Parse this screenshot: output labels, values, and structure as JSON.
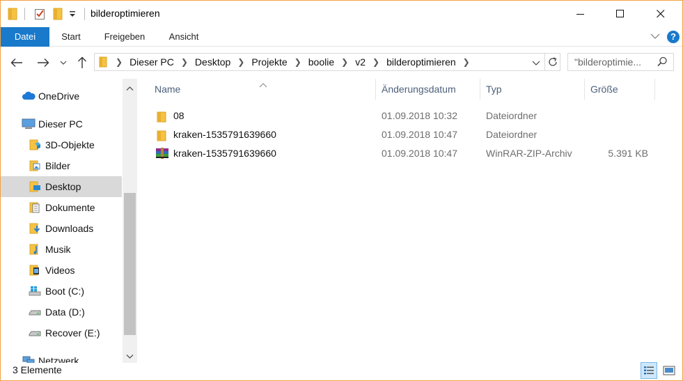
{
  "window": {
    "title": "bilderoptimieren",
    "controls": {
      "minimize": "—",
      "maximize": "☐",
      "close": "✕"
    }
  },
  "ribbon": {
    "tabs": [
      {
        "label": "Datei"
      },
      {
        "label": "Start"
      },
      {
        "label": "Freigeben"
      },
      {
        "label": "Ansicht"
      }
    ],
    "help_label": "?"
  },
  "address": {
    "crumbs": [
      "Dieser PC",
      "Desktop",
      "Projekte",
      "boolie",
      "v2",
      "bilderoptimieren"
    ],
    "search_placeholder": "\"bilderoptimie..."
  },
  "sidebar": {
    "items": [
      {
        "label": "OneDrive",
        "icon": "onedrive-cloud-icon"
      },
      {
        "label": "Dieser PC",
        "icon": "computer-icon"
      },
      {
        "label": "3D-Objekte",
        "icon": "3d-objects-folder-icon"
      },
      {
        "label": "Bilder",
        "icon": "pictures-folder-icon"
      },
      {
        "label": "Desktop",
        "icon": "desktop-folder-icon",
        "selected": true
      },
      {
        "label": "Dokumente",
        "icon": "documents-folder-icon"
      },
      {
        "label": "Downloads",
        "icon": "downloads-folder-icon"
      },
      {
        "label": "Musik",
        "icon": "music-folder-icon"
      },
      {
        "label": "Videos",
        "icon": "videos-folder-icon"
      },
      {
        "label": "Boot (C:)",
        "icon": "windows-drive-icon"
      },
      {
        "label": "Data (D:)",
        "icon": "drive-icon"
      },
      {
        "label": "Recover (E:)",
        "icon": "drive-icon"
      },
      {
        "label": "Netzwerk",
        "icon": "network-icon"
      }
    ]
  },
  "list": {
    "columns": [
      "Name",
      "Änderungsdatum",
      "Typ",
      "Größe"
    ],
    "rows": [
      {
        "name": "08",
        "date": "01.09.2018 10:32",
        "type": "Dateiordner",
        "size": "",
        "icon": "folder-icon"
      },
      {
        "name": "kraken-1535791639660",
        "date": "01.09.2018 10:47",
        "type": "Dateiordner",
        "size": "",
        "icon": "folder-icon"
      },
      {
        "name": "kraken-1535791639660",
        "date": "01.09.2018 10:47",
        "type": "WinRAR-ZIP-Archiv",
        "size": "5.391 KB",
        "icon": "winrar-archive-icon"
      }
    ]
  },
  "status": {
    "count_text": "3 Elemente"
  },
  "colors": {
    "accent": "#1979ca",
    "folder": "#f6c242",
    "selection": "#d9d9d9"
  }
}
